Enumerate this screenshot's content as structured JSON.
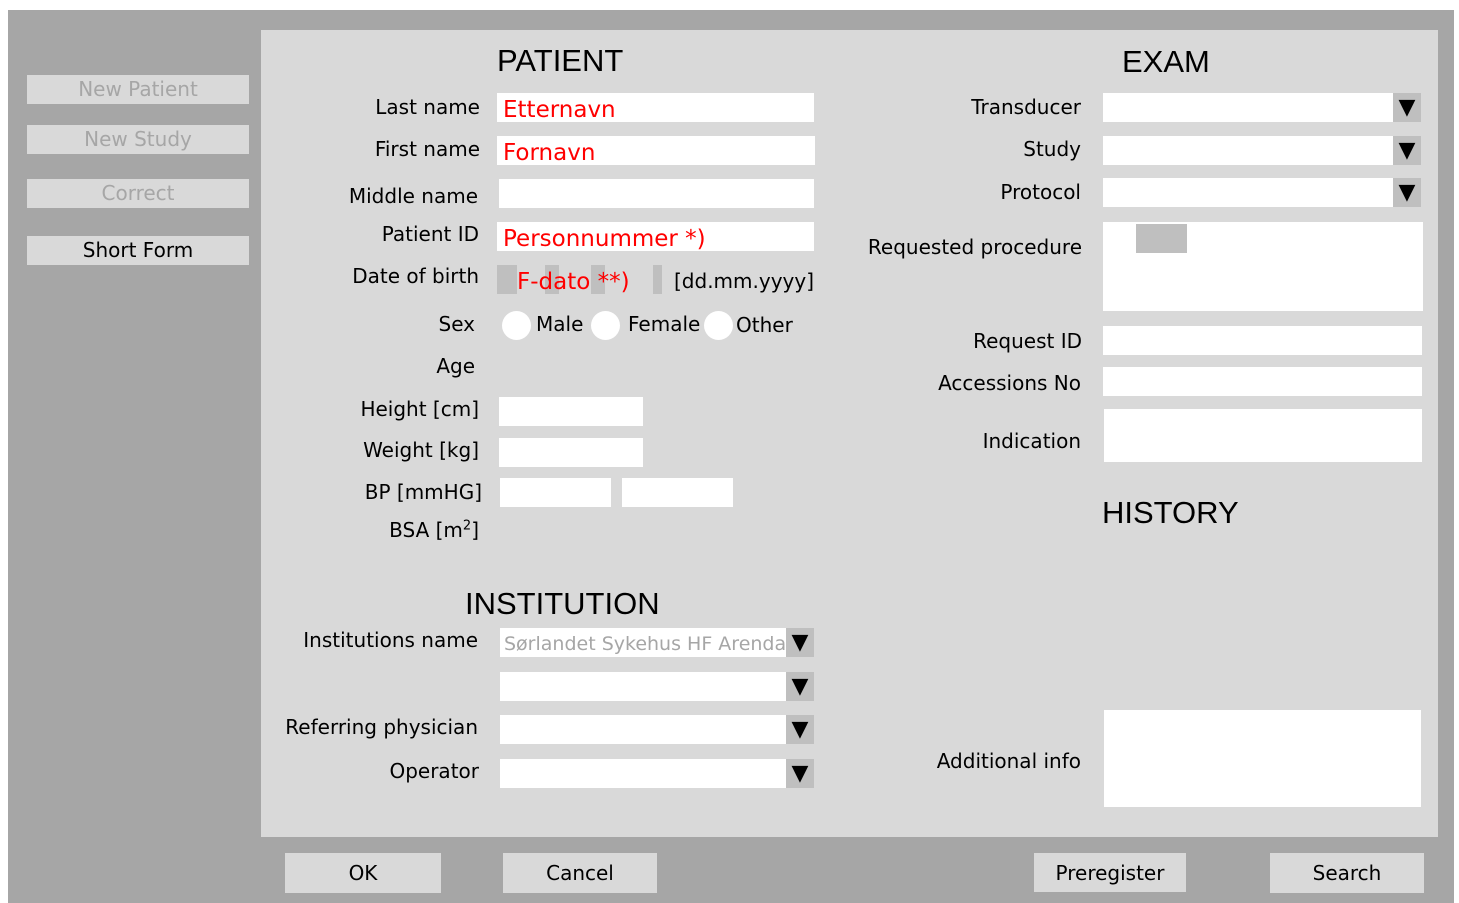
{
  "sidebar": {
    "new_patient": "New Patient",
    "new_study": "New Study",
    "correct": "Correct",
    "short_form": "Short Form"
  },
  "patient": {
    "heading": "PATIENT",
    "last_name_label": "Last name",
    "last_name_value": "Etternavn",
    "first_name_label": "First name",
    "first_name_value": "Fornavn",
    "middle_name_label": "Middle name",
    "middle_name_value": "",
    "patient_id_label": "Patient ID",
    "patient_id_value": "Personnummer *)",
    "dob_label": "Date of birth",
    "dob_value": "F-dato **)",
    "dob_format": "[dd.mm.yyyy]",
    "sex_label": "Sex",
    "sex_male": "Male",
    "sex_female": "Female",
    "sex_other": "Other",
    "age_label": "Age",
    "height_label": "Height [cm]",
    "height_value": "",
    "weight_label": "Weight [kg]",
    "weight_value": "",
    "bp_label": "BP [mmHG]",
    "bp_sys_value": "",
    "bp_dia_value": "",
    "bsa_label": "BSA [m",
    "bsa_sup": "2",
    "bsa_close": "]"
  },
  "institution": {
    "heading": "INSTITUTION",
    "name_label": "Institutions name",
    "name_value": "Sørlandet Sykehus HF Arendal",
    "department_value": "",
    "referring_label": "Referring physician",
    "referring_value": "",
    "operator_label": "Operator",
    "operator_value": ""
  },
  "exam": {
    "heading": "EXAM",
    "transducer_label": "Transducer",
    "transducer_value": "",
    "study_label": "Study",
    "study_value": "",
    "protocol_label": "Protocol",
    "protocol_value": "",
    "requested_procedure_label": "Requested procedure",
    "request_id_label": "Request ID",
    "request_id_value": "",
    "accessions_label": "Accessions No",
    "accessions_value": "",
    "indication_label": "Indication",
    "indication_value": ""
  },
  "history": {
    "heading": "HISTORY",
    "additional_info_label": "Additional info",
    "additional_info_value": ""
  },
  "dropdown_glyph": "▼",
  "footer": {
    "ok": "OK",
    "cancel": "Cancel",
    "preregister": "Preregister",
    "search": "Search"
  }
}
